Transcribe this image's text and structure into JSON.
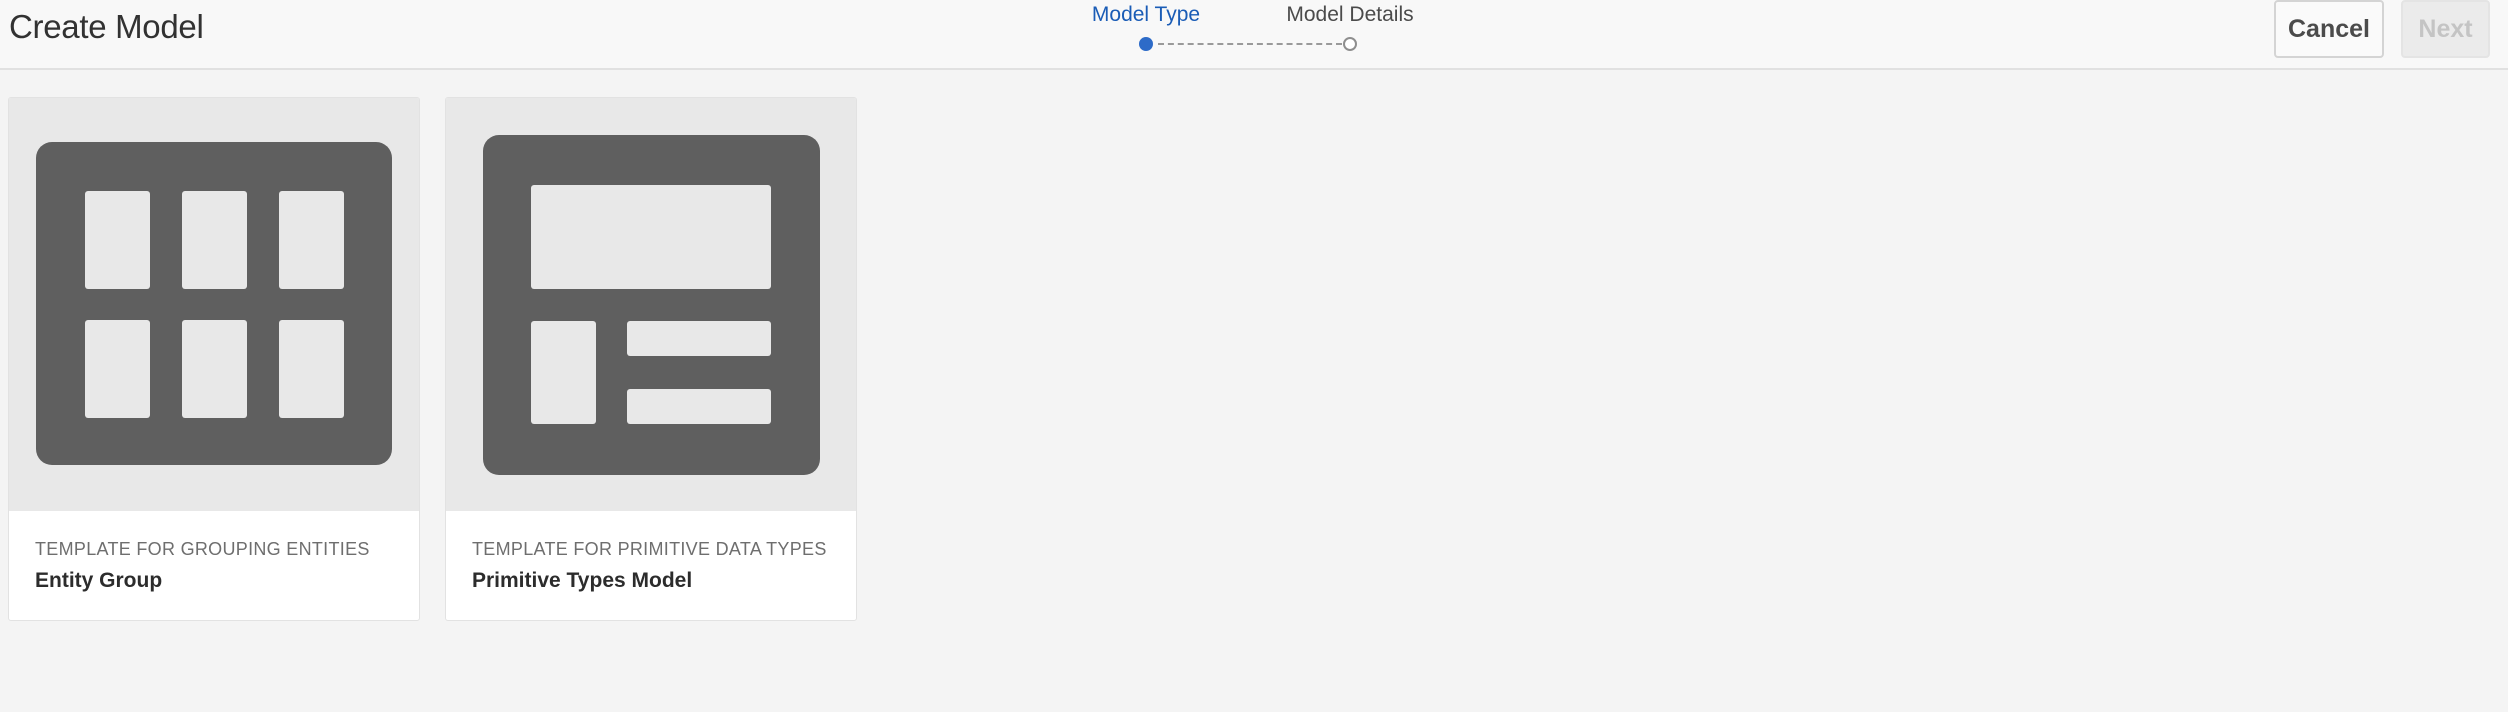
{
  "header": {
    "title": "Create Model",
    "cancel_label": "Cancel",
    "next_label": "Next"
  },
  "stepper": {
    "steps": [
      {
        "label": "Model Type",
        "state": "active"
      },
      {
        "label": "Model Details",
        "state": "inactive"
      }
    ]
  },
  "cards": [
    {
      "subtitle": "TEMPLATE FOR GROUPING ENTITIES",
      "title": "Entity Group",
      "icon": "grid-layout-icon"
    },
    {
      "subtitle": "TEMPLATE FOR PRIMITIVE DATA TYPES",
      "title": "Primitive Types Model",
      "icon": "form-layout-icon"
    }
  ],
  "colors": {
    "accent": "#2d6bc8",
    "icon_dark": "#5f5f5f",
    "icon_light": "#e8e8e8"
  }
}
